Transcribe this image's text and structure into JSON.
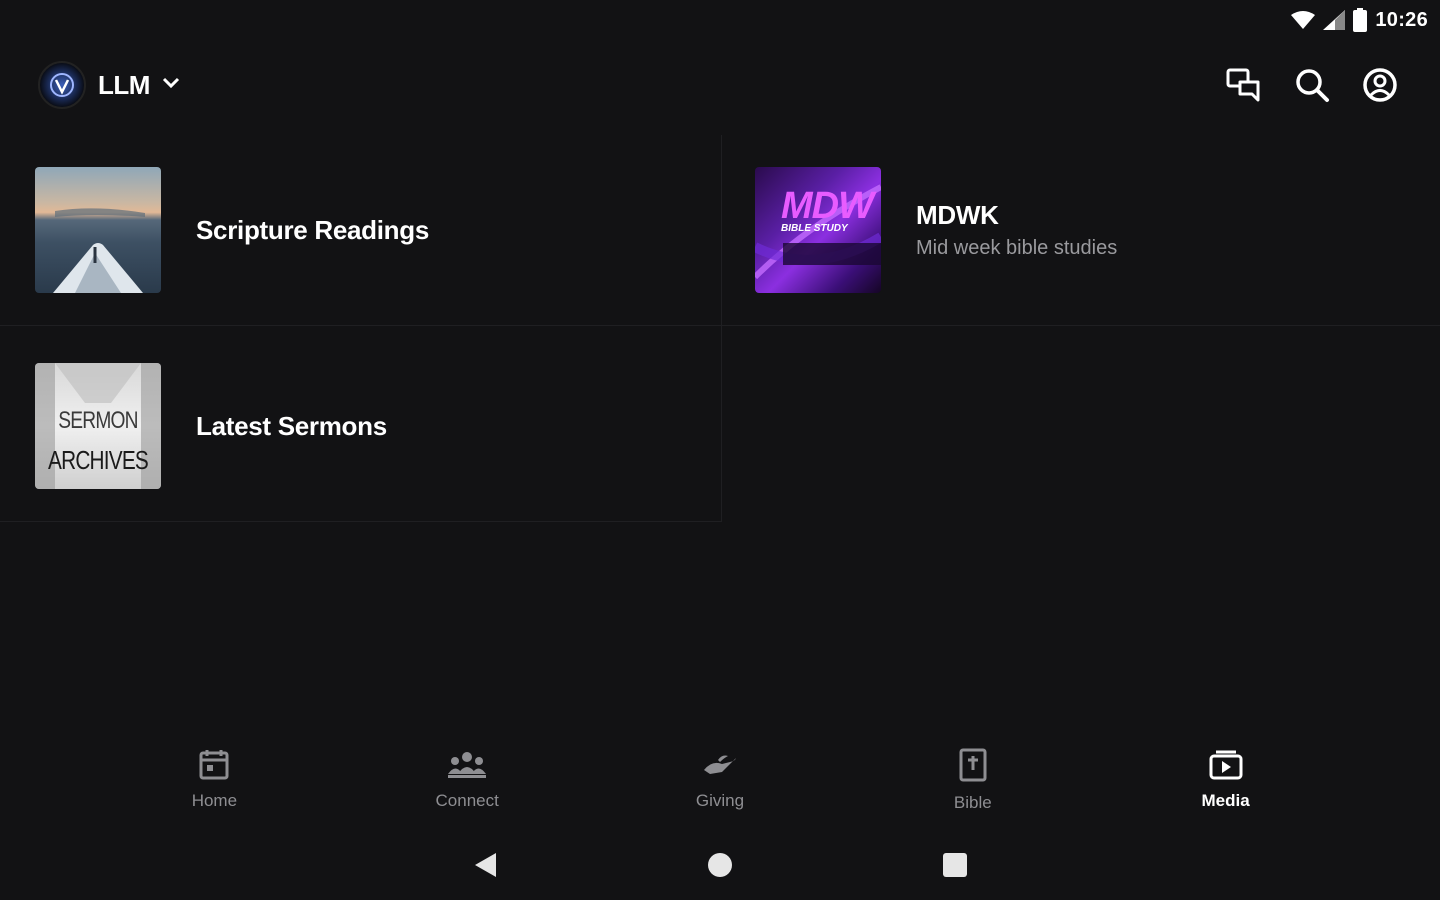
{
  "status_bar": {
    "time": "10:26",
    "icons": [
      "wifi-icon",
      "cell-signal-icon",
      "battery-icon"
    ]
  },
  "app_bar": {
    "org_name": "LLM",
    "org_dropdown_icon": "chevron-down-icon",
    "actions": [
      "chat-icon",
      "search-icon",
      "account-icon"
    ]
  },
  "media_list": [
    {
      "title": "Scripture Readings",
      "subtitle": ""
    },
    {
      "title": "MDWK",
      "subtitle": "Mid week bible studies"
    },
    {
      "title": "Latest Sermons",
      "subtitle": ""
    }
  ],
  "thumbnails": {
    "mdwk_logo_text": "MDW",
    "mdwk_banner_text": "BIBLE STUDY",
    "sermon_line_1": "SERMON",
    "sermon_line_2": "ARCHIVES"
  },
  "bottom_nav": {
    "items": [
      {
        "label": "Home",
        "icon": "calendar-icon",
        "active": false
      },
      {
        "label": "Connect",
        "icon": "people-icon",
        "active": false
      },
      {
        "label": "Giving",
        "icon": "giving-hand-icon",
        "active": false
      },
      {
        "label": "Bible",
        "icon": "bible-icon",
        "active": false
      },
      {
        "label": "Media",
        "icon": "media-play-icon",
        "active": true
      }
    ]
  },
  "system_nav": [
    "back-icon",
    "home-icon",
    "recents-icon"
  ],
  "colors": {
    "background": "#121214",
    "divider": "#1f1f22",
    "inactive": "#8e8e92",
    "active": "#ffffff",
    "subtitle": "#9a9a9e"
  }
}
